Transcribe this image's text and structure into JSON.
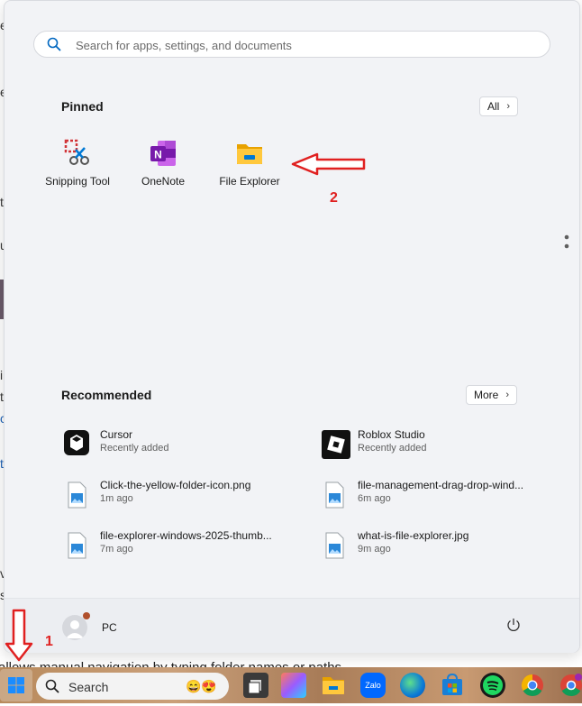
{
  "background": {
    "fragments": [
      "e",
      "e",
      "t",
      "u",
      "i",
      "t",
      "c",
      "t",
      "v",
      "s"
    ],
    "bottom_line": "allows manual navigation by typing folder names or paths."
  },
  "search": {
    "placeholder": "Search for apps, settings, and documents"
  },
  "pinned": {
    "title": "Pinned",
    "all_label": "All",
    "apps": [
      {
        "label": "Snipping Tool",
        "icon": "snipping-tool-icon"
      },
      {
        "label": "OneNote",
        "icon": "onenote-icon"
      },
      {
        "label": "File Explorer",
        "icon": "file-explorer-icon"
      }
    ]
  },
  "recommended": {
    "title": "Recommended",
    "more_label": "More",
    "items": [
      {
        "name": "Cursor",
        "sub": "Recently added"
      },
      {
        "name": "Roblox Studio",
        "sub": "Recently added"
      },
      {
        "name": "Click-the-yellow-folder-icon.png",
        "sub": "1m ago"
      },
      {
        "name": "file-management-drag-drop-wind...",
        "sub": "6m ago"
      },
      {
        "name": "file-explorer-windows-2025-thumb...",
        "sub": "7m ago"
      },
      {
        "name": "what-is-file-explorer.jpg",
        "sub": "9m ago"
      }
    ]
  },
  "user": {
    "name": "PC"
  },
  "annotations": {
    "step1": "1",
    "step2": "2"
  },
  "taskbar": {
    "search_label": "Search",
    "zalo_label": "Zalo"
  },
  "colors": {
    "annotation_red": "#e02020",
    "accent_blue": "#0067c0"
  }
}
